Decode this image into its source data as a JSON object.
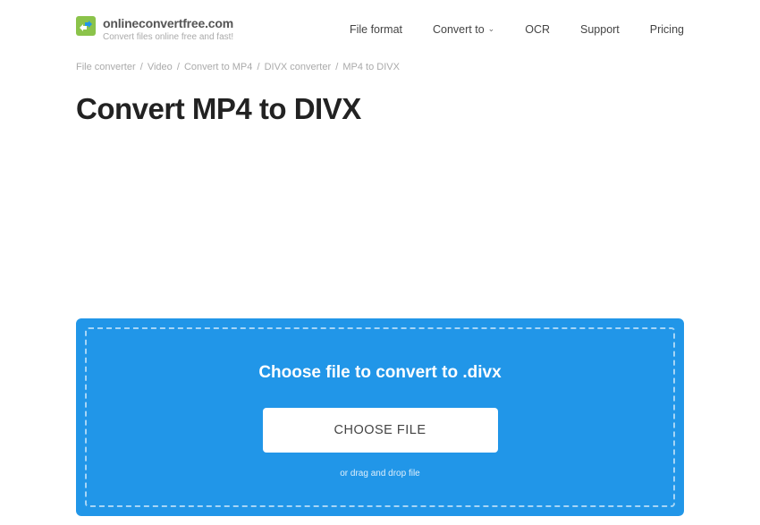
{
  "brand": {
    "title": "onlineconvertfree.com",
    "subtitle": "Convert files online free and fast!"
  },
  "nav": {
    "file_format": "File format",
    "convert_to": "Convert to",
    "ocr": "OCR",
    "support": "Support",
    "pricing": "Pricing"
  },
  "breadcrumb": {
    "file_converter": "File converter",
    "video": "Video",
    "convert_to_mp4": "Convert to MP4",
    "divx_converter": "DIVX converter",
    "mp4_to_divx": "MP4 to DIVX"
  },
  "page": {
    "title": "Convert MP4 to DIVX"
  },
  "upload": {
    "title": "Choose file to convert to .divx",
    "button": "CHOOSE FILE",
    "hint": "or drag and drop file"
  }
}
